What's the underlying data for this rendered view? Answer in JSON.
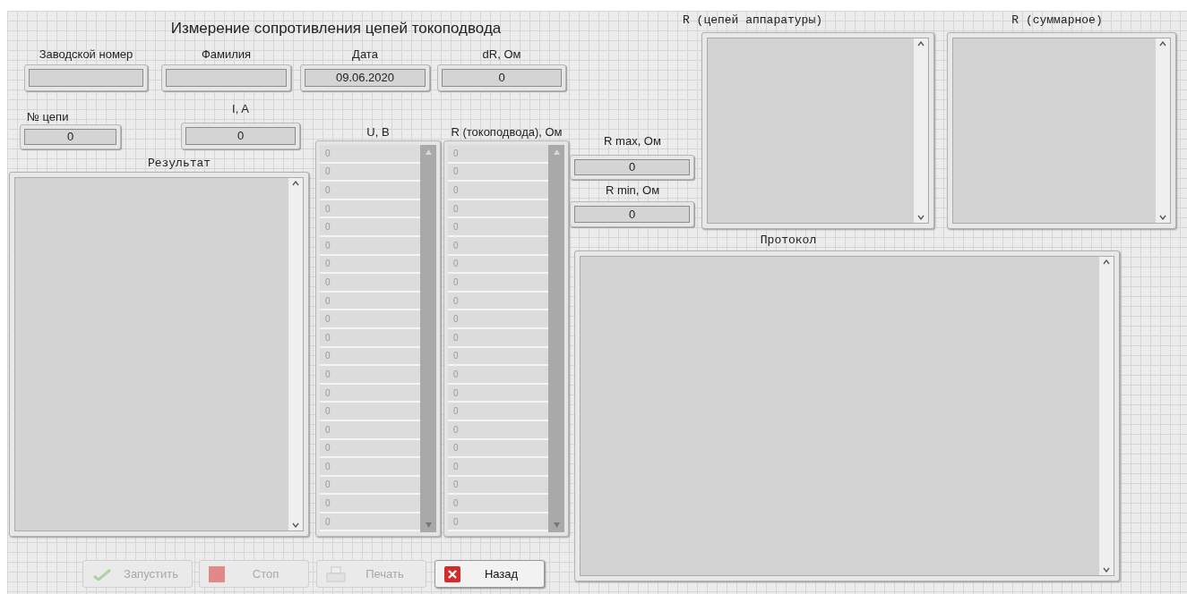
{
  "title": "Измерение сопротивления цепей токоподвода",
  "top_fields": [
    {
      "label": "Заводской номер"
    },
    {
      "label": "Фамилия"
    },
    {
      "label": "Дата",
      "value": "09.06.2020"
    },
    {
      "label": "dR, Ом",
      "value": "0"
    }
  ],
  "circuit": {
    "label": "№ цепи",
    "value": "0"
  },
  "current": {
    "label": "I, A",
    "value": "0"
  },
  "arrays": [
    {
      "label": "U, B",
      "values": [
        "0",
        "0",
        "0",
        "0",
        "0",
        "0",
        "0",
        "0",
        "0",
        "0",
        "0",
        "0",
        "0",
        "0",
        "0",
        "0",
        "0",
        "0",
        "0",
        "0",
        "0"
      ]
    },
    {
      "label": "R (токоподвода), Ом",
      "values": [
        "0",
        "0",
        "0",
        "0",
        "0",
        "0",
        "0",
        "0",
        "0",
        "0",
        "0",
        "0",
        "0",
        "0",
        "0",
        "0",
        "0",
        "0",
        "0",
        "0",
        "0"
      ]
    }
  ],
  "result": {
    "label": "Результат"
  },
  "rmax": {
    "label": "R max, Ом",
    "value": "0"
  },
  "rmin": {
    "label": "R min, Ом",
    "value": "0"
  },
  "r_circuits": {
    "label": "R (цепей аппаратуры)"
  },
  "r_total": {
    "label": "R (суммарное)"
  },
  "protocol": {
    "label": "Протокол"
  },
  "buttons": [
    {
      "kind": "run",
      "label": "Запустить",
      "disabled": true
    },
    {
      "kind": "stop",
      "label": "Стоп",
      "disabled": true
    },
    {
      "kind": "print",
      "label": "Печать",
      "disabled": true
    },
    {
      "kind": "back",
      "label": "Назад",
      "disabled": false
    }
  ]
}
